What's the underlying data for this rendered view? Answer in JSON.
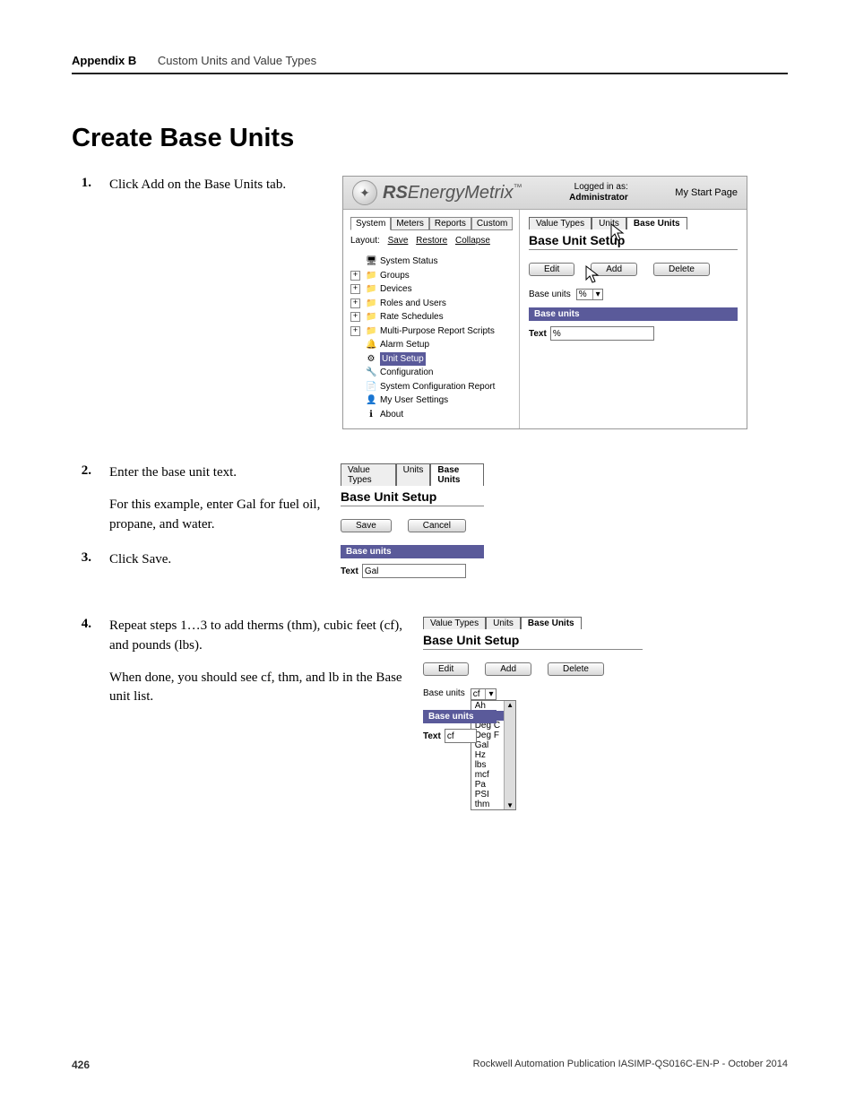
{
  "doc": {
    "appendix": "Appendix B",
    "chapter": "Custom Units and Value Types",
    "title": "Create Base Units",
    "page_num": "426",
    "pub_line": "Rockwell Automation Publication IASIMP-QS016C-EN-P - October 2014"
  },
  "steps": {
    "s1": "Click Add on the Base Units tab.",
    "s2": "Enter the base unit text.",
    "s2_note": "For this example, enter Gal for fuel oil, propane, and water.",
    "s3": "Click Save.",
    "s4": "Repeat steps 1…3 to add therms (thm), cubic feet (cf), and pounds (lbs).",
    "s4_note": "When done, you should see cf, thm, and lb in the Base unit list."
  },
  "shot1": {
    "brand": "RSEnergyMetrix",
    "tm": "™",
    "logged_label": "Logged in as:",
    "logged_user": "Administrator",
    "start_link": "My Start Page",
    "sys_tabs": [
      "System",
      "Meters",
      "Reports",
      "Custom"
    ],
    "layout_label": "Layout:",
    "layout_links": [
      "Save",
      "Restore",
      "Collapse"
    ],
    "tree": [
      {
        "icon": "🖥",
        "label": "System Status"
      },
      {
        "icon": "📁",
        "label": "Groups",
        "exp": true
      },
      {
        "icon": "📁",
        "label": "Devices",
        "exp": true
      },
      {
        "icon": "📁",
        "label": "Roles and Users",
        "exp": true
      },
      {
        "icon": "📁",
        "label": "Rate Schedules",
        "exp": true
      },
      {
        "icon": "📁",
        "label": "Multi-Purpose Report Scripts",
        "exp": true
      },
      {
        "icon": "🔔",
        "label": "Alarm Setup"
      },
      {
        "icon": "⚙",
        "label": "Unit Setup",
        "sel": true
      },
      {
        "icon": "🔧",
        "label": "Configuration"
      },
      {
        "icon": "📄",
        "label": "System Configuration Report"
      },
      {
        "icon": "👤",
        "label": "My User Settings"
      },
      {
        "icon": "ℹ",
        "label": "About"
      }
    ],
    "type_tabs": [
      "Value Types",
      "Units",
      "Base Units"
    ],
    "section": "Base Unit Setup",
    "buttons": [
      "Edit",
      "Add",
      "Delete"
    ],
    "base_units_label": "Base units",
    "base_units_value": "%",
    "dark_bar": "Base units",
    "text_label": "Text",
    "text_value": "%"
  },
  "shot2": {
    "type_tabs": [
      "Value Types",
      "Units",
      "Base Units"
    ],
    "section": "Base Unit Setup",
    "buttons": [
      "Save",
      "Cancel"
    ],
    "dark_bar": "Base units",
    "text_label": "Text",
    "text_value": "Gal"
  },
  "shot3": {
    "type_tabs": [
      "Value Types",
      "Units",
      "Base Units"
    ],
    "section": "Base Unit Setup",
    "buttons": [
      "Edit",
      "Add",
      "Delete"
    ],
    "base_units_label": "Base units",
    "selected": "cf",
    "dark_bar": "Base units",
    "text_label": "Text",
    "text_value": "cf",
    "options": [
      "Ah",
      "cf",
      "Deg C",
      "Deg F",
      "Gal",
      "Hz",
      "lbs",
      "mcf",
      "Pa",
      "PSI",
      "thm"
    ]
  }
}
